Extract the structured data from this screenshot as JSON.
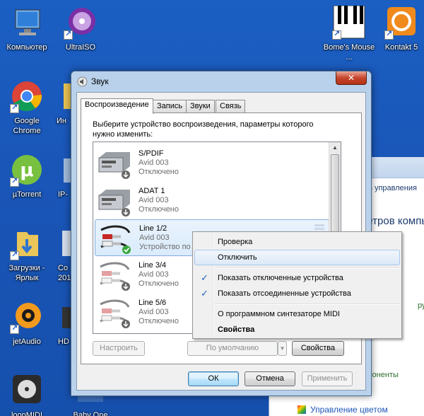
{
  "desktop": {
    "icons": [
      {
        "label": "Компьютер",
        "icon": "computer-icon"
      },
      {
        "label": "UltraISO",
        "icon": "disc-icon"
      },
      {
        "label": "Bome's Mouse ...",
        "icon": "piano-keys-icon"
      },
      {
        "label": "Kontakt 5",
        "icon": "kontakt-icon"
      },
      {
        "label": "Google Chrome",
        "icon": "chrome-icon"
      },
      {
        "label": "Ин",
        "icon": "folder-icon"
      },
      {
        "label": "µTorrent",
        "icon": "utorrent-icon"
      },
      {
        "label": "IP-",
        "icon": "ip-icon"
      },
      {
        "label": "Загрузки - Ярлык",
        "icon": "downloads-folder-icon"
      },
      {
        "label": "Co 201",
        "icon": "app-icon"
      },
      {
        "label": "jetAudio",
        "icon": "jetaudio-icon"
      },
      {
        "label": "HD",
        "icon": "hd-icon"
      },
      {
        "label": "loopMIDI",
        "icon": "midi-icon"
      },
      {
        "label": "Baby One",
        "icon": "app-icon"
      }
    ]
  },
  "background_window": {
    "text1": "ель управления",
    "text2": "метров компь",
    "text3": "ругие д",
    "text4": "мпоненты",
    "text5": "Управление цветом"
  },
  "dialog": {
    "title": "Звук",
    "close_label": "✕",
    "tabs": [
      "Воспроизведение",
      "Запись",
      "Звуки",
      "Связь"
    ],
    "instruction": "Выберите устройство воспроизведения, параметры которого нужно изменить:",
    "devices": [
      {
        "name": "S/PDIF",
        "driver": "Avid 003",
        "status": "Отключено"
      },
      {
        "name": "ADAT 1",
        "driver": "Avid 003",
        "status": "Отключено"
      },
      {
        "name": "Line 1/2",
        "driver": "Avid 003",
        "status": "Устройство по"
      },
      {
        "name": "Line 3/4",
        "driver": "Avid 003",
        "status": "Отключено"
      },
      {
        "name": "Line 5/6",
        "driver": "Avid 003",
        "status": "Отключено"
      }
    ],
    "buttons": {
      "configure": "Настроить",
      "default": "По умолчанию",
      "properties": "Свойства",
      "ok": "ОК",
      "cancel": "Отмена",
      "apply": "Применить"
    }
  },
  "context_menu": {
    "items": [
      {
        "label": "Проверка",
        "checked": false
      },
      {
        "label": "Отключить",
        "checked": false
      },
      {
        "label": "Показать отключенные устройства",
        "checked": true
      },
      {
        "label": "Показать отсоединенные устройства",
        "checked": true
      },
      {
        "label": "О программном синтезаторе MIDI",
        "checked": false
      },
      {
        "label": "Свойства",
        "checked": false
      }
    ],
    "check_glyph": "✓"
  }
}
